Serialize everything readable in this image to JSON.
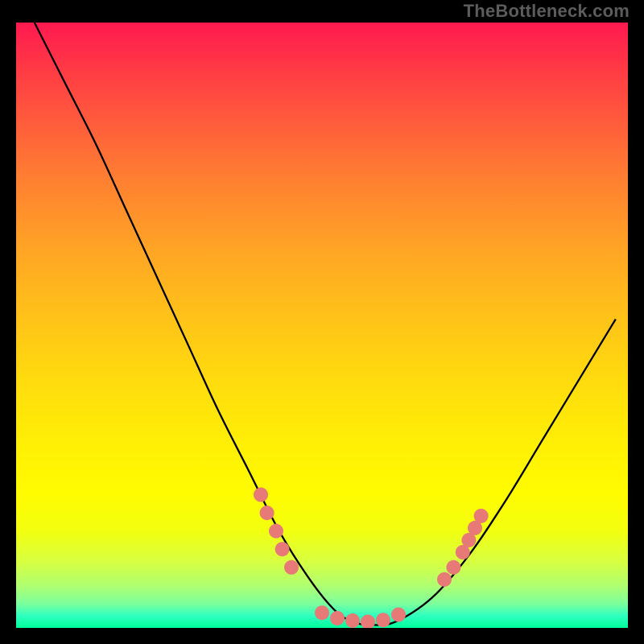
{
  "watermark": "TheBottleneck.com",
  "chart_data": {
    "type": "line",
    "title": "",
    "xlabel": "",
    "ylabel": "",
    "xlim": [
      0,
      100
    ],
    "ylim": [
      0,
      100
    ],
    "grid": false,
    "legend": false,
    "gradient_stops": [
      {
        "pos": 0,
        "color": "#ff1950"
      },
      {
        "pos": 50,
        "color": "#ffdb0e"
      },
      {
        "pos": 80,
        "color": "#fffc00"
      },
      {
        "pos": 100,
        "color": "#00ff9a"
      }
    ],
    "series": [
      {
        "name": "bottleneck-curve",
        "color": "#000000",
        "x": [
          3,
          8,
          13,
          18,
          23,
          28,
          33,
          38,
          43,
          48,
          52,
          55,
          58,
          62,
          68,
          74,
          80,
          86,
          92,
          98
        ],
        "y": [
          100,
          90,
          80,
          69,
          58,
          47,
          36,
          26,
          16,
          8,
          3,
          1,
          0.5,
          1,
          5,
          12,
          21,
          31,
          41,
          51
        ]
      }
    ],
    "markers": {
      "name": "highlight-dots",
      "color": "#e77a76",
      "radius": 9,
      "points": [
        {
          "x": 40,
          "y": 22
        },
        {
          "x": 41,
          "y": 19
        },
        {
          "x": 42.5,
          "y": 16
        },
        {
          "x": 43.5,
          "y": 13
        },
        {
          "x": 45,
          "y": 10
        },
        {
          "x": 50,
          "y": 2.5
        },
        {
          "x": 52.5,
          "y": 1.6
        },
        {
          "x": 55,
          "y": 1.2
        },
        {
          "x": 57.5,
          "y": 1.0
        },
        {
          "x": 60,
          "y": 1.3
        },
        {
          "x": 62.5,
          "y": 2.2
        },
        {
          "x": 70,
          "y": 8
        },
        {
          "x": 71.5,
          "y": 10
        },
        {
          "x": 73,
          "y": 12.5
        },
        {
          "x": 74,
          "y": 14.5
        },
        {
          "x": 75,
          "y": 16.5
        },
        {
          "x": 76,
          "y": 18.5
        }
      ]
    }
  }
}
